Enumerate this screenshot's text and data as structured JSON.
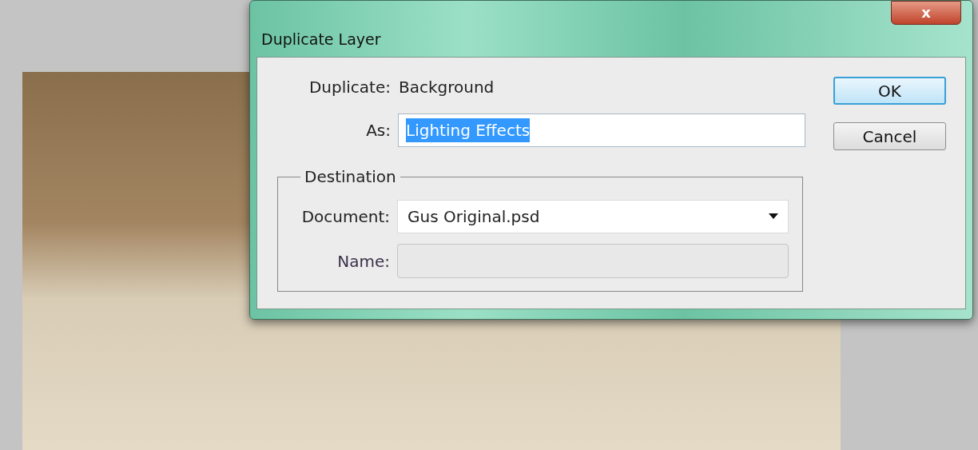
{
  "dialog": {
    "title": "Duplicate Layer",
    "close_label": "x",
    "duplicate": {
      "label": "Duplicate:",
      "value": "Background"
    },
    "as_field": {
      "label": "As:",
      "value": "Lighting Effects",
      "selected": true
    },
    "destination": {
      "legend": "Destination",
      "document": {
        "label": "Document:",
        "value": "Gus Original.psd"
      },
      "name": {
        "label": "Name:",
        "disabled": true
      }
    },
    "buttons": [
      {
        "label": "OK",
        "default": true
      },
      {
        "label": "Cancel",
        "default": false
      }
    ]
  }
}
